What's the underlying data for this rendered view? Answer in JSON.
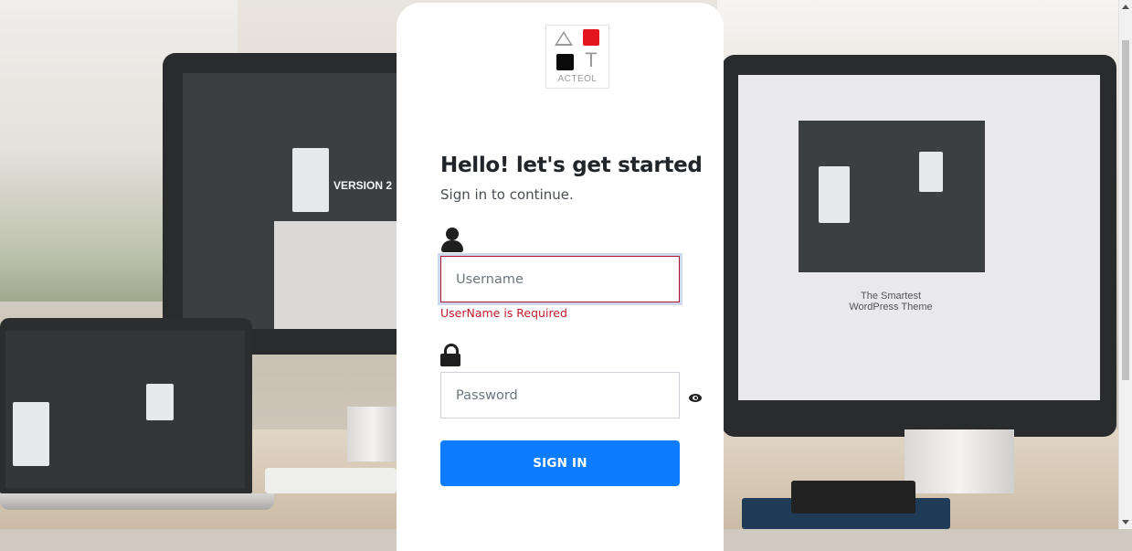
{
  "logo": {
    "text": "ACTEOL",
    "letter": "T"
  },
  "login": {
    "heading": "Hello! let's get started",
    "subheading": "Sign in to continue.",
    "username_placeholder": "Username",
    "username_value": "",
    "username_error": "UserName is Required",
    "password_placeholder": "Password",
    "password_value": "",
    "submit_label": "SIGN IN"
  },
  "icons": {
    "user": "user-icon",
    "lock": "lock-icon",
    "eye": "eye-icon"
  },
  "background": {
    "screen_text_center": "VERSION 2",
    "screen_text_right": "The Smartest WordPress Theme"
  },
  "colors": {
    "primary_button": "#0d7cff",
    "error": "#c21a2a",
    "logo_red": "#e3161f"
  }
}
